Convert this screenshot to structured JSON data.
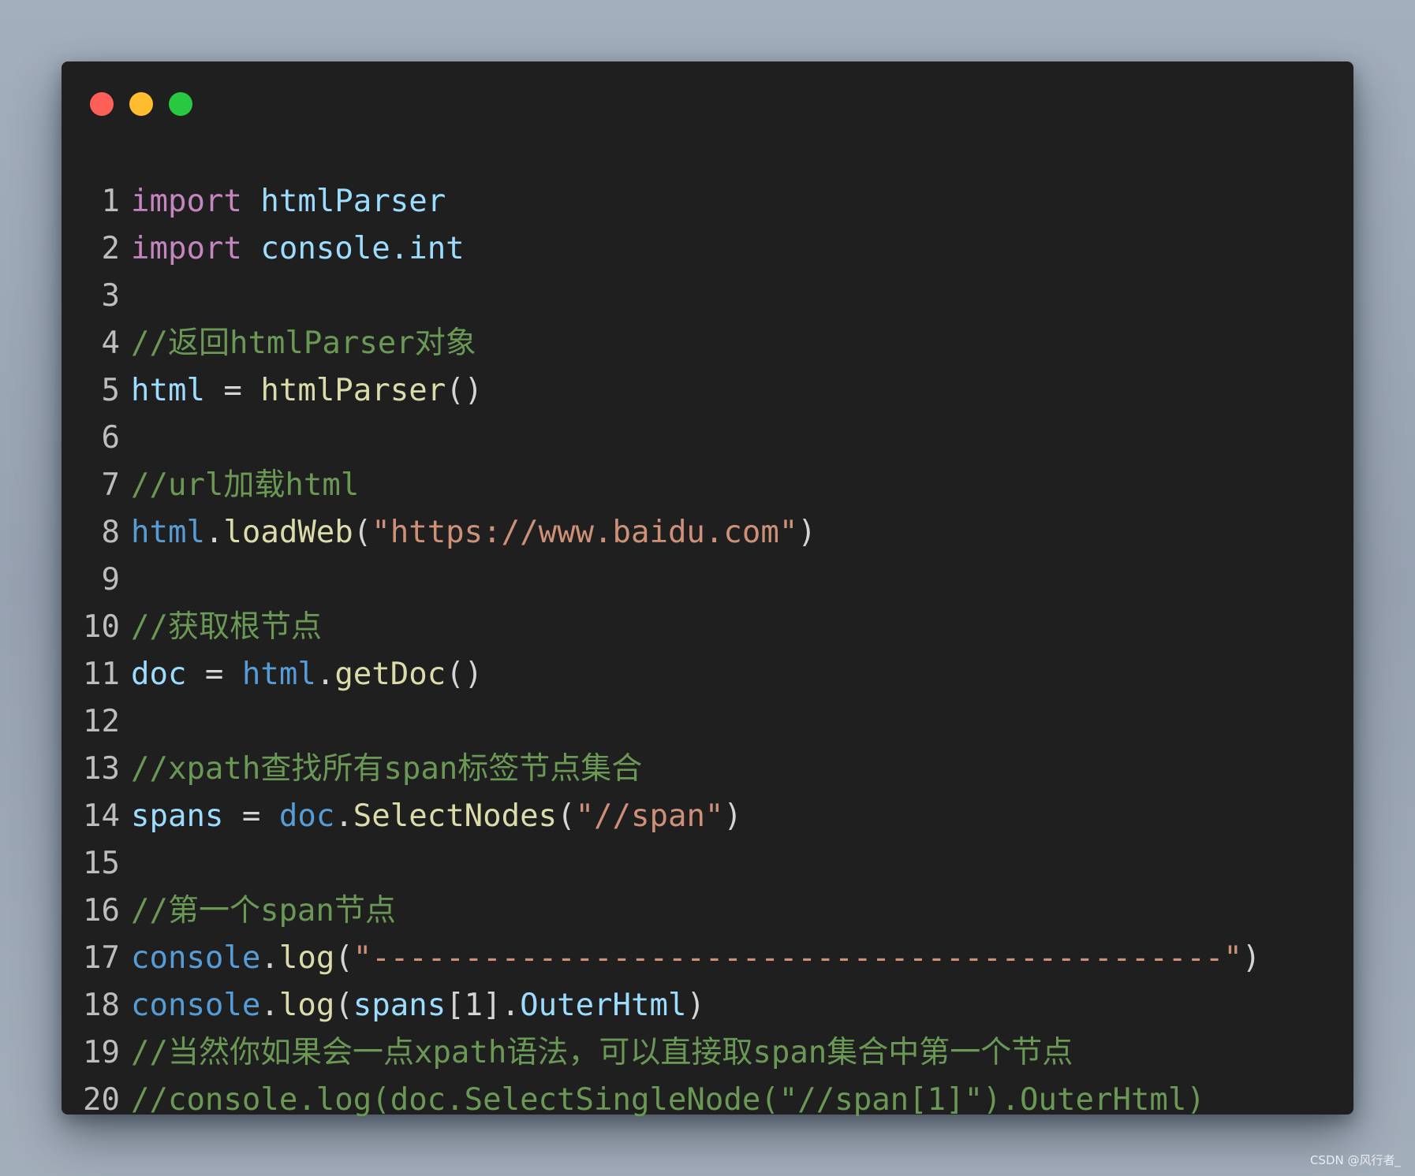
{
  "colors": {
    "page_background": "#9ea9b7",
    "editor_background": "#1f1f1f",
    "traffic_red": "#fe5f57",
    "traffic_yellow": "#febc2e",
    "traffic_green": "#28c840",
    "line_number": "#bdbdbd",
    "keyword": "#c586c0",
    "variable": "#9cdcfe",
    "object": "#569cd6",
    "function": "#dcdcaa",
    "string": "#ce9178",
    "comment": "#6a9955",
    "operator": "#d4d4d4"
  },
  "window_controls": [
    {
      "name": "close-dot",
      "color": "#fe5f57"
    },
    {
      "name": "minimize-dot",
      "color": "#febc2e"
    },
    {
      "name": "maximize-dot",
      "color": "#28c840"
    }
  ],
  "code": {
    "lines": [
      {
        "n": "1",
        "tokens": [
          {
            "t": "import",
            "c": "kw"
          },
          {
            "t": " ",
            "c": "op"
          },
          {
            "t": "htmlParser",
            "c": "var"
          }
        ]
      },
      {
        "n": "2",
        "tokens": [
          {
            "t": "import",
            "c": "kw"
          },
          {
            "t": " ",
            "c": "op"
          },
          {
            "t": "console.int",
            "c": "var"
          }
        ]
      },
      {
        "n": "3",
        "tokens": []
      },
      {
        "n": "4",
        "tokens": [
          {
            "t": "//返回htmlParser对象",
            "c": "com"
          }
        ]
      },
      {
        "n": "5",
        "tokens": [
          {
            "t": "html",
            "c": "var"
          },
          {
            "t": " = ",
            "c": "op"
          },
          {
            "t": "htmlParser",
            "c": "fn"
          },
          {
            "t": "()",
            "c": "op"
          }
        ]
      },
      {
        "n": "6",
        "tokens": []
      },
      {
        "n": "7",
        "tokens": [
          {
            "t": "//url加载html",
            "c": "com"
          }
        ]
      },
      {
        "n": "8",
        "tokens": [
          {
            "t": "html",
            "c": "obj"
          },
          {
            "t": ".",
            "c": "op"
          },
          {
            "t": "loadWeb",
            "c": "fn"
          },
          {
            "t": "(",
            "c": "op"
          },
          {
            "t": "\"https://www.baidu.com\"",
            "c": "str"
          },
          {
            "t": ")",
            "c": "op"
          }
        ]
      },
      {
        "n": "9",
        "tokens": []
      },
      {
        "n": "10",
        "tokens": [
          {
            "t": "//获取根节点",
            "c": "com"
          }
        ]
      },
      {
        "n": "11",
        "tokens": [
          {
            "t": "doc",
            "c": "var"
          },
          {
            "t": " = ",
            "c": "op"
          },
          {
            "t": "html",
            "c": "obj"
          },
          {
            "t": ".",
            "c": "op"
          },
          {
            "t": "getDoc",
            "c": "fn"
          },
          {
            "t": "()",
            "c": "op"
          }
        ]
      },
      {
        "n": "12",
        "tokens": []
      },
      {
        "n": "13",
        "tokens": [
          {
            "t": "//xpath查找所有span标签节点集合",
            "c": "com"
          }
        ]
      },
      {
        "n": "14",
        "tokens": [
          {
            "t": "spans",
            "c": "var"
          },
          {
            "t": " = ",
            "c": "op"
          },
          {
            "t": "doc",
            "c": "obj"
          },
          {
            "t": ".",
            "c": "op"
          },
          {
            "t": "SelectNodes",
            "c": "fn"
          },
          {
            "t": "(",
            "c": "op"
          },
          {
            "t": "\"//span\"",
            "c": "str"
          },
          {
            "t": ")",
            "c": "op"
          }
        ]
      },
      {
        "n": "15",
        "tokens": []
      },
      {
        "n": "16",
        "tokens": [
          {
            "t": "//第一个span节点",
            "c": "com"
          }
        ]
      },
      {
        "n": "17",
        "tokens": [
          {
            "t": "console",
            "c": "obj"
          },
          {
            "t": ".",
            "c": "op"
          },
          {
            "t": "log",
            "c": "fn"
          },
          {
            "t": "(",
            "c": "op"
          },
          {
            "t": "\"----------------------------------------------\"",
            "c": "str"
          },
          {
            "t": ")",
            "c": "op"
          }
        ]
      },
      {
        "n": "18",
        "tokens": [
          {
            "t": "console",
            "c": "obj"
          },
          {
            "t": ".",
            "c": "op"
          },
          {
            "t": "log",
            "c": "fn"
          },
          {
            "t": "(",
            "c": "op"
          },
          {
            "t": "spans",
            "c": "var"
          },
          {
            "t": "[1].",
            "c": "op"
          },
          {
            "t": "OuterHtml",
            "c": "var"
          },
          {
            "t": ")",
            "c": "op"
          }
        ]
      },
      {
        "n": "19",
        "tokens": [
          {
            "t": "//当然你如果会一点xpath语法，可以直接取span集合中第一个节点",
            "c": "com"
          }
        ]
      },
      {
        "n": "20",
        "tokens": [
          {
            "t": "//console.log(doc.SelectSingleNode(\"//span[1]\").OuterHtml)",
            "c": "com"
          }
        ]
      }
    ]
  },
  "watermark": "CSDN @风行者_"
}
